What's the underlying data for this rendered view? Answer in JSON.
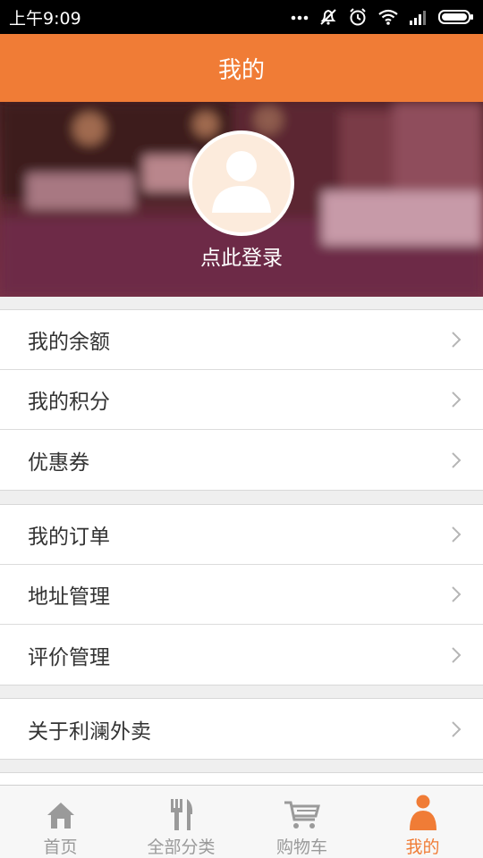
{
  "status_bar": {
    "time": "上午9:09"
  },
  "header": {
    "title": "我的"
  },
  "profile": {
    "login_text": "点此登录"
  },
  "menu_groups": [
    {
      "items": [
        {
          "label": "我的余额"
        },
        {
          "label": "我的积分"
        },
        {
          "label": "优惠券"
        }
      ]
    },
    {
      "items": [
        {
          "label": "我的订单"
        },
        {
          "label": "地址管理"
        },
        {
          "label": "评价管理"
        }
      ]
    },
    {
      "items": [
        {
          "label": "关于利澜外卖"
        }
      ]
    }
  ],
  "bottom_nav": [
    {
      "label": "首页",
      "icon": "home-icon",
      "active": false
    },
    {
      "label": "全部分类",
      "icon": "fork-knife-icon",
      "active": false
    },
    {
      "label": "购物车",
      "icon": "cart-icon",
      "active": false
    },
    {
      "label": "我的",
      "icon": "user-icon",
      "active": true
    }
  ],
  "colors": {
    "accent": "#f07c36",
    "avatar_bg": "#fcebdc",
    "inactive": "#9a9a9a"
  }
}
